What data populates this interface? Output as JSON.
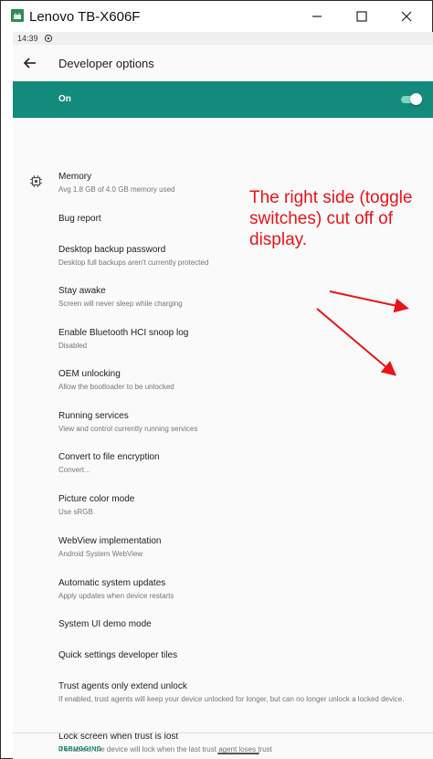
{
  "window": {
    "title": "Lenovo TB-X606F"
  },
  "statusbar": {
    "time": "14:39"
  },
  "appbar": {
    "title": "Developer options"
  },
  "master_switch": {
    "label": "On",
    "state": "on"
  },
  "settings": [
    {
      "title": "Memory",
      "subtitle": "Avg 1.8 GB of 4.0 GB memory used",
      "icon": "memory-chip-icon"
    },
    {
      "title": "Bug report",
      "subtitle": ""
    },
    {
      "title": "Desktop backup password",
      "subtitle": "Desktop full backups aren't currently protected"
    },
    {
      "title": "Stay awake",
      "subtitle": "Screen will never sleep while charging"
    },
    {
      "title": "Enable Bluetooth HCI snoop log",
      "subtitle": "Disabled"
    },
    {
      "title": "OEM unlocking",
      "subtitle": "Allow the bootloader to be unlocked"
    },
    {
      "title": "Running services",
      "subtitle": "View and control currently running services"
    },
    {
      "title": "Convert to file encryption",
      "subtitle": "Convert..."
    },
    {
      "title": "Picture color mode",
      "subtitle": "Use sRGB"
    },
    {
      "title": "WebView implementation",
      "subtitle": "Android System WebView"
    },
    {
      "title": "Automatic system updates",
      "subtitle": "Apply updates when device restarts"
    },
    {
      "title": "System UI demo mode",
      "subtitle": ""
    },
    {
      "title": "Quick settings developer tiles",
      "subtitle": ""
    },
    {
      "title": "Trust agents only extend unlock",
      "subtitle": "If enabled, trust agents will keep your device unlocked for longer, but can no longer unlock a locked device."
    },
    {
      "title": "Lock screen when trust is lost",
      "subtitle": "If enabled, the device will lock when the last trust agent loses trust"
    }
  ],
  "section_header": "DEBUGGING",
  "annotation": {
    "text": "The right side (toggle switches) cut off of display."
  },
  "colors": {
    "accent": "#128a7c",
    "annotation": "#e8141a"
  }
}
